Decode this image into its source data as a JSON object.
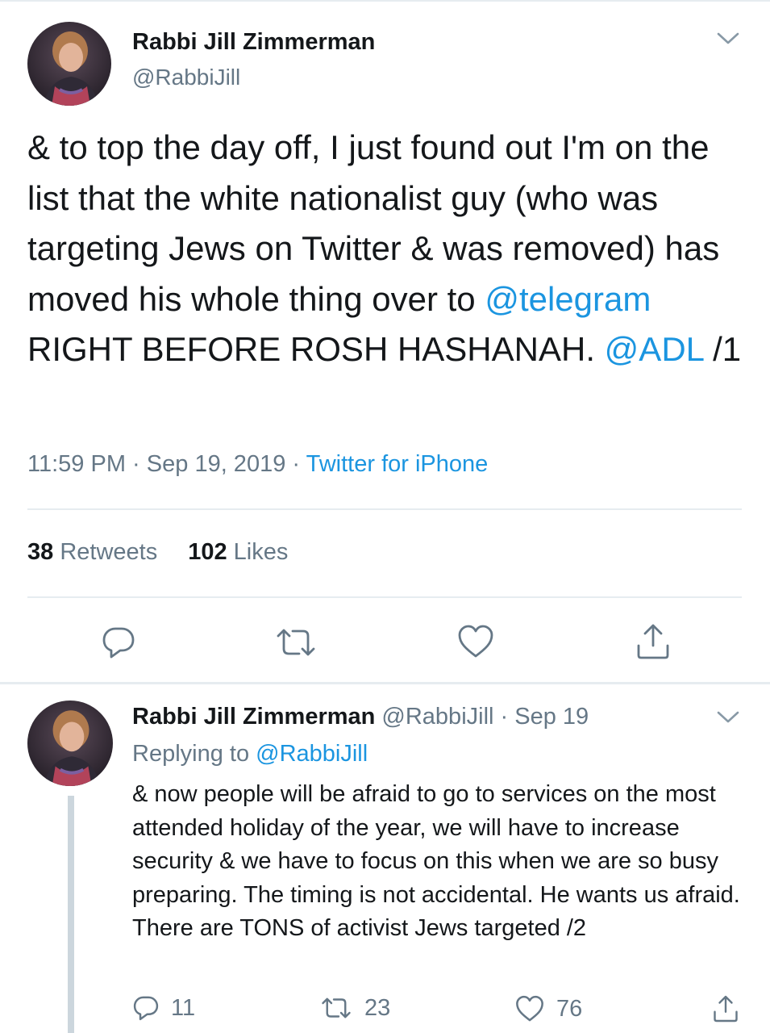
{
  "main_tweet": {
    "author_name": "Rabbi Jill Zimmerman",
    "author_handle": "@RabbiJill",
    "text_part1": "& to top the day off, I just found out I'm on the list that the white nationalist guy (who was targeting Jews on Twitter & was removed) has moved his whole thing over to ",
    "mention1": "@telegram",
    "text_part2": " RIGHT BEFORE ROSH HASHANAH. ",
    "mention2": "@ADL",
    "text_part3": " /1",
    "time": "11:59 PM",
    "date": "Sep 19, 2019",
    "separator": "·",
    "source": "Twitter for iPhone",
    "retweets_count": "38",
    "retweets_label": "Retweets",
    "likes_count": "102",
    "likes_label": "Likes",
    "icons": {
      "menu": "chevron-down-icon",
      "reply": "reply-icon",
      "retweet": "retweet-icon",
      "like": "heart-icon",
      "share": "share-icon"
    }
  },
  "reply_tweet": {
    "author_name": "Rabbi Jill Zimmerman",
    "author_handle": "@RabbiJill",
    "separator": "·",
    "date": "Sep 19",
    "replying_to_label": "Replying to",
    "replying_to_handle": "@RabbiJill",
    "text": "& now people will be afraid to go to services on the most attended holiday of the year, we will have to increase security & we have to focus on this when we are so busy preparing. The timing is not accidental. He wants us afraid. There are TONS of activist Jews targeted /2",
    "reply_count": "11",
    "retweet_count": "23",
    "like_count": "76"
  },
  "colors": {
    "link": "#1b95e0",
    "text": "#14171a",
    "secondary": "#657786",
    "divider": "#e6ecf0",
    "thread_line": "#ccd6dd"
  }
}
